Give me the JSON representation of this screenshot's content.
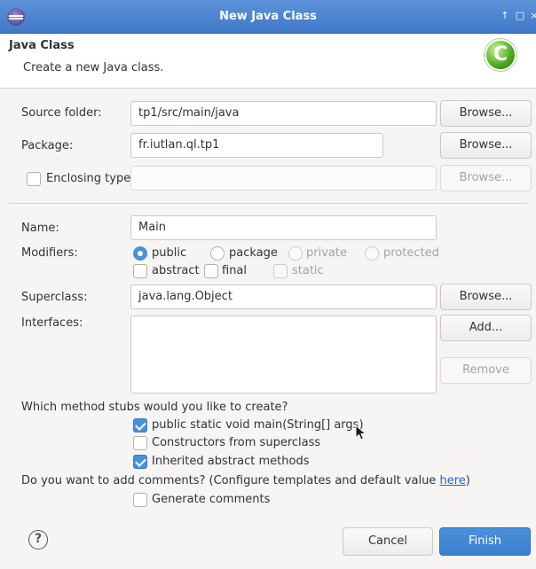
{
  "window": {
    "title": "New Java Class",
    "controls": {
      "pin": "↑",
      "maximize": "□",
      "close": "×"
    }
  },
  "header": {
    "title": "Java Class",
    "description": "Create a new Java class.",
    "badge_letter": "C"
  },
  "source_folder": {
    "label": "Source folder:",
    "value": "tp1/src/main/java",
    "button": "Browse..."
  },
  "package": {
    "label": "Package:",
    "value": "fr.iutlan.ql.tp1",
    "button": "Browse..."
  },
  "enclosing_type": {
    "label": "Enclosing type:",
    "value": "",
    "checked": false,
    "button": "Browse..."
  },
  "name": {
    "label": "Name:",
    "value": "Main"
  },
  "modifiers": {
    "label": "Modifiers:",
    "access": [
      {
        "label": "public",
        "selected": true,
        "enabled": true
      },
      {
        "label": "package",
        "selected": false,
        "enabled": true
      },
      {
        "label": "private",
        "selected": false,
        "enabled": false
      },
      {
        "label": "protected",
        "selected": false,
        "enabled": false
      }
    ],
    "other": [
      {
        "label": "abstract",
        "checked": false,
        "enabled": true
      },
      {
        "label": "final",
        "checked": false,
        "enabled": true
      },
      {
        "label": "static",
        "checked": false,
        "enabled": false
      }
    ]
  },
  "superclass": {
    "label": "Superclass:",
    "value": "java.lang.Object",
    "button": "Browse..."
  },
  "interfaces": {
    "label": "Interfaces:",
    "add_button": "Add...",
    "remove_button": "Remove"
  },
  "method_stubs": {
    "question": "Which method stubs would you like to create?",
    "options": [
      {
        "label": "public static void main(String[] args)",
        "checked": true
      },
      {
        "label": "Constructors from superclass",
        "checked": false
      },
      {
        "label": "Inherited abstract methods",
        "checked": true
      }
    ]
  },
  "comments": {
    "question_prefix": "Do you want to add comments? (Configure templates and default value ",
    "link": "here",
    "question_suffix": ")",
    "option": {
      "label": "Generate comments",
      "checked": false
    }
  },
  "footer": {
    "help": "?",
    "cancel": "Cancel",
    "finish": "Finish"
  }
}
